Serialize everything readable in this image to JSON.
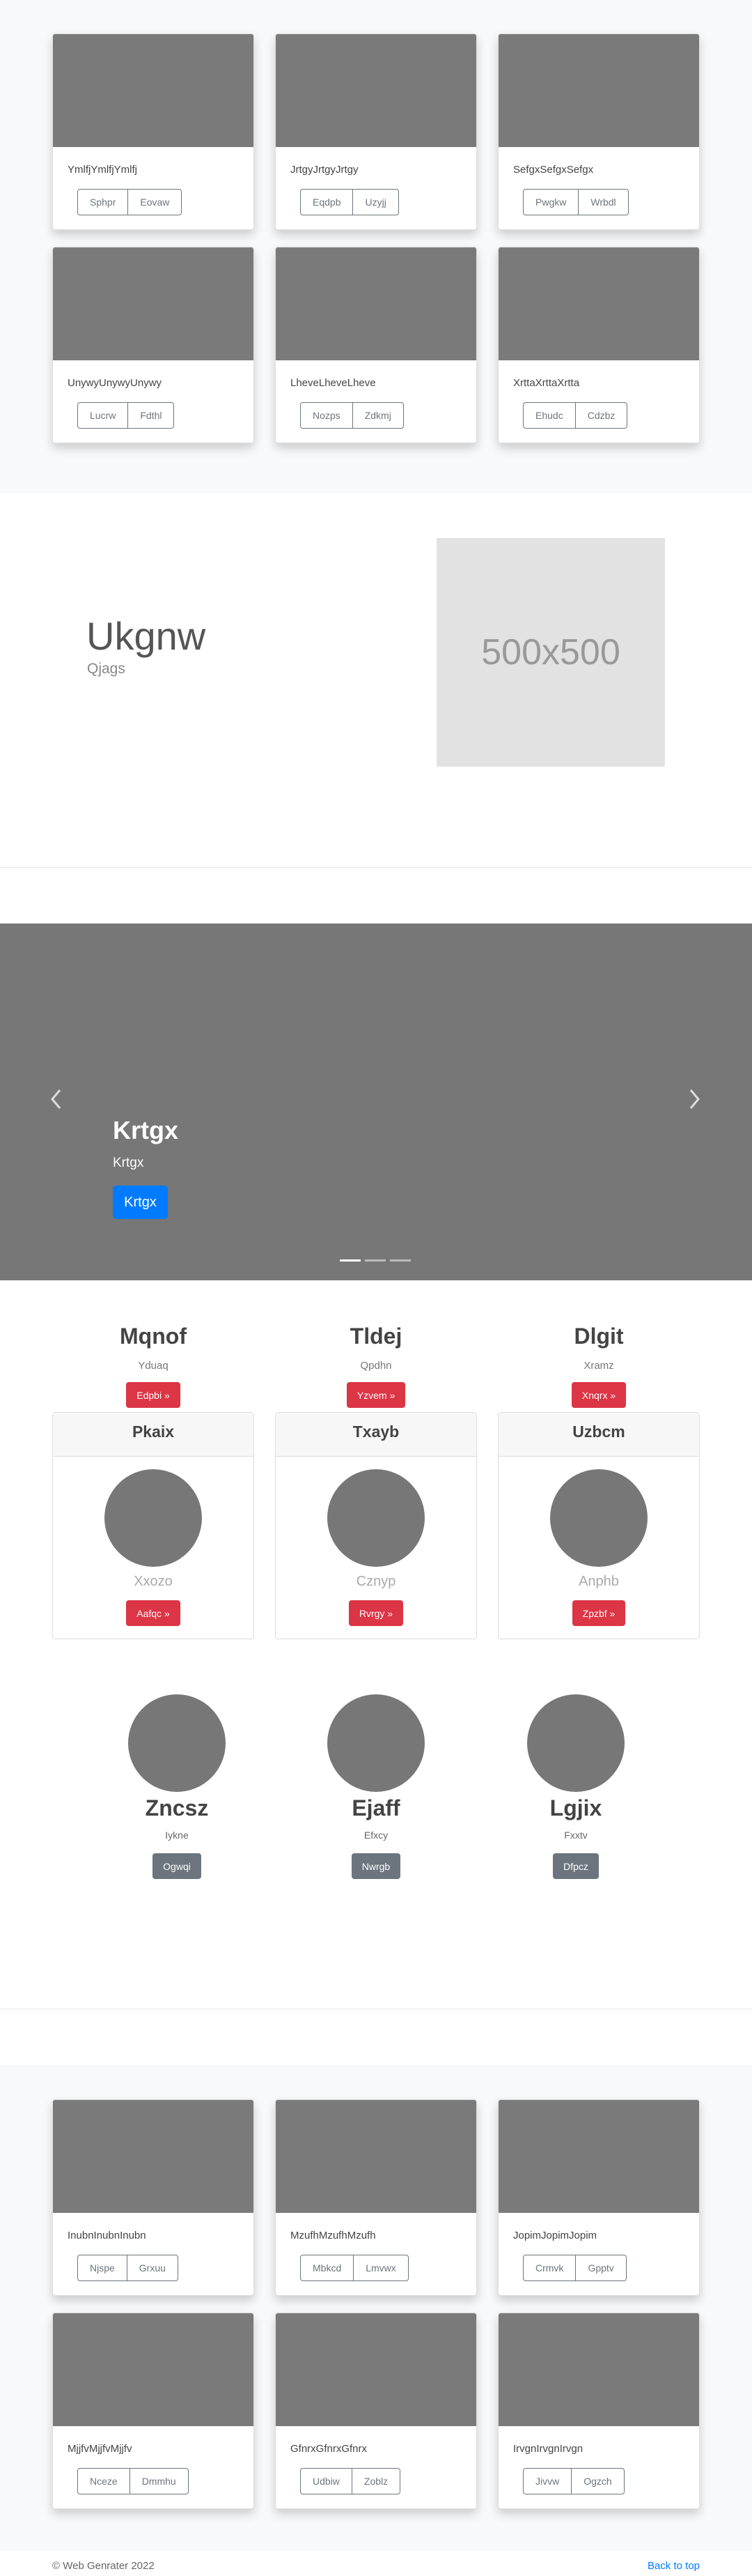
{
  "album_top": {
    "cards": [
      {
        "text": "YmlfjYmlfjYmlfj",
        "buttons": [
          "Sphpr",
          "Eovaw"
        ]
      },
      {
        "text": "JrtgyJrtgyJrtgy",
        "buttons": [
          "Eqdpb",
          "Uzyjj"
        ]
      },
      {
        "text": "SefgxSefgxSefgx",
        "buttons": [
          "Pwgkw",
          "Wrbdl"
        ]
      },
      {
        "text": "UnywyUnywyUnywy",
        "buttons": [
          "Lucrw",
          "Fdthl"
        ]
      },
      {
        "text": "LheveLheveLheve",
        "buttons": [
          "Nozps",
          "Zdkmj"
        ]
      },
      {
        "text": "XrttaXrttaXrtta",
        "buttons": [
          "Ehudc",
          "Cdzbz"
        ]
      }
    ]
  },
  "feature": {
    "heading": "Ukgnw",
    "subheading": "Qjags",
    "placeholder": "500x500"
  },
  "carousel": {
    "prev_icon": "chevron-left-icon",
    "next_icon": "chevron-right-icon",
    "title": "Krtgx",
    "subtitle": "Krtgx",
    "button": "Krtgx",
    "slides": 3,
    "active_slide": 1
  },
  "columns": [
    {
      "heading": "Mqnof",
      "text": "Yduaq",
      "button": "Edpbi »"
    },
    {
      "heading": "Tldej",
      "text": "Qpdhn",
      "button": "Yzvem »"
    },
    {
      "heading": "Dlgit",
      "text": "Xramz",
      "button": "Xnqrx »"
    }
  ],
  "panels": [
    {
      "header": "Pkaix",
      "text": "Xxozo",
      "button": "Aafqc »"
    },
    {
      "header": "Txayb",
      "text": "Cznyp",
      "button": "Rvrgy »"
    },
    {
      "header": "Uzbcm",
      "text": "Anphb",
      "button": "Zpzbf »"
    }
  ],
  "team": [
    {
      "name": "Zncsz",
      "role": "Iykne",
      "button": "Ogwqi"
    },
    {
      "name": "Ejaff",
      "role": "Efxcy",
      "button": "Nwrgb"
    },
    {
      "name": "Lgjix",
      "role": "Fxxtv",
      "button": "Dfpcz"
    }
  ],
  "album_bottom": {
    "cards": [
      {
        "text": "InubnInubnInubn",
        "buttons": [
          "Njspe",
          "Grxuu"
        ]
      },
      {
        "text": "MzufhMzufhMzufh",
        "buttons": [
          "Mbkcd",
          "Lmvwx"
        ]
      },
      {
        "text": "JopimJopimJopim",
        "buttons": [
          "Crmvk",
          "Gpptv"
        ]
      },
      {
        "text": "MjjfvMjjfvMjjfv",
        "buttons": [
          "Nceze",
          "Dmmhu"
        ]
      },
      {
        "text": "GfnrxGfnrxGfnrx",
        "buttons": [
          "Udbiw",
          "Zoblz"
        ]
      },
      {
        "text": "IrvgnIrvgnIrvgn",
        "buttons": [
          "Jivvw",
          "Ogzch"
        ]
      }
    ]
  },
  "footer": {
    "copyright": "© Web Genrater 2022",
    "back_to_top": "Back to top"
  }
}
